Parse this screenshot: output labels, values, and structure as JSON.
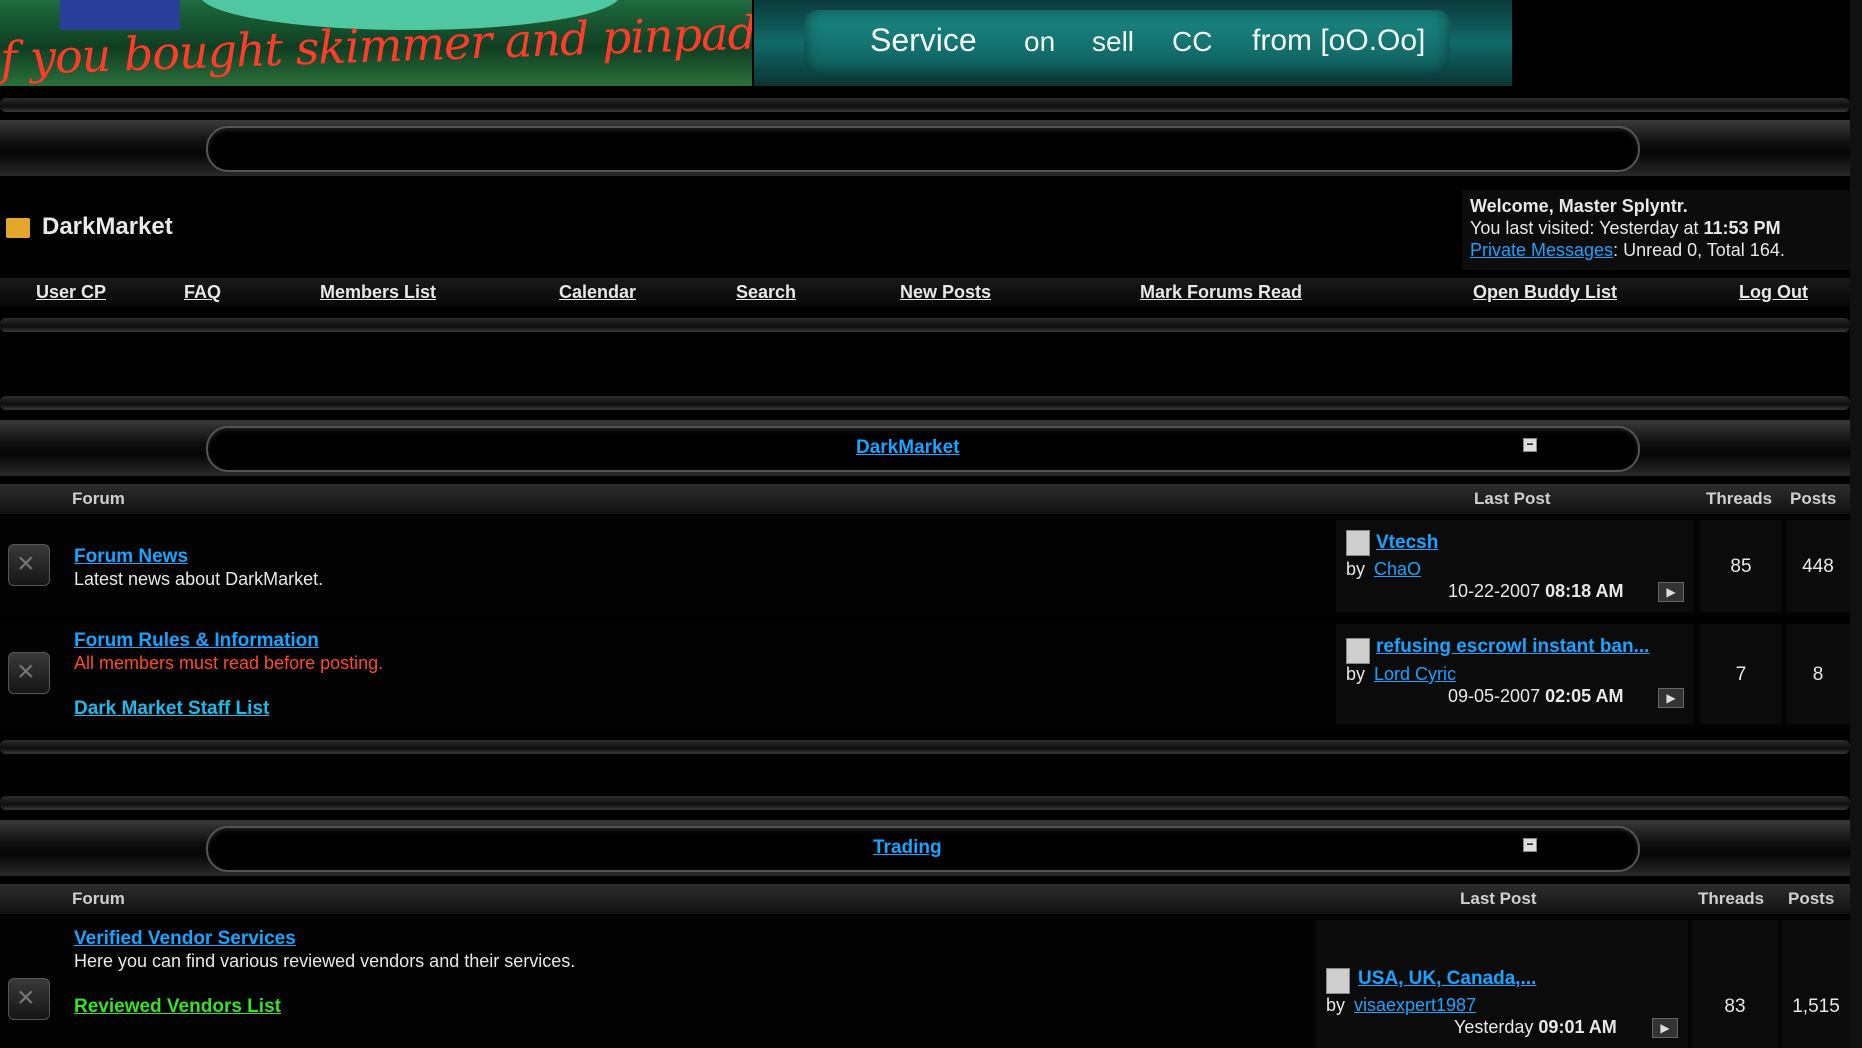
{
  "banner": {
    "left_text": "f you bought skimmer and pinpad from ChaO",
    "service": "Service",
    "on": "on",
    "sell": "sell",
    "cc": "CC",
    "from": "from [oO.Oo]"
  },
  "breadcrumb": {
    "title": "DarkMarket"
  },
  "welcome": {
    "line1": "Welcome, Master Splyntr.",
    "visited_prefix": "You last visited: Yesterday at",
    "visited_time": "11:53 PM",
    "pm_link": "Private Messages",
    "pm_stats": ": Unread 0, Total 164."
  },
  "nav": {
    "user_cp": "User CP",
    "faq": "FAQ",
    "members": "Members List",
    "calendar": "Calendar",
    "search": "Search",
    "new_posts": "New Posts",
    "mark_read": "Mark Forums Read",
    "buddy": "Open Buddy List",
    "logout": "Log Out"
  },
  "cat1": {
    "title": "DarkMarket",
    "col_forum": "Forum",
    "col_lastpost": "Last Post",
    "col_threads": "Threads",
    "col_posts": "Posts",
    "forums": [
      {
        "name": "Forum News",
        "desc": "Latest news about DarkMarket.",
        "last_title": "Vtecsh",
        "by": "by",
        "last_user": "ChaO",
        "last_date": "10-22-2007",
        "last_time": "08:18 AM",
        "threads": "85",
        "posts": "448"
      },
      {
        "name": "Forum Rules & Information",
        "desc": "All members must read before posting.",
        "sub": "Dark Market Staff List",
        "last_title": "refusing escrowl instant ban...",
        "by": "by",
        "last_user": "Lord Cyric",
        "last_date": "09-05-2007",
        "last_time": "02:05 AM",
        "threads": "7",
        "posts": "8"
      }
    ]
  },
  "cat2": {
    "title": "Trading",
    "col_forum": "Forum",
    "col_lastpost": "Last Post",
    "col_threads": "Threads",
    "col_posts": "Posts",
    "forums": [
      {
        "name": "Verified Vendor Services",
        "desc": "Here you can find various reviewed vendors and their services.",
        "sub": "Reviewed Vendors List",
        "last_title": "USA, UK, Canada,...",
        "by": "by",
        "last_user": "visaexpert1987",
        "last_date": "Yesterday",
        "last_time": "09:01 AM",
        "threads": "83",
        "posts": "1,515"
      }
    ]
  }
}
